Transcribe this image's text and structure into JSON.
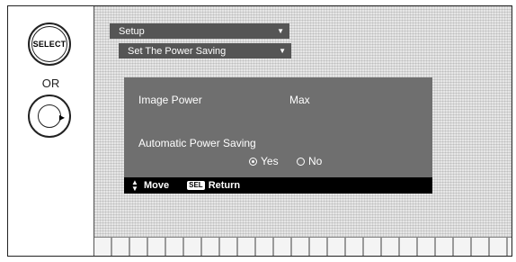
{
  "remote": {
    "select_label": "SELECT",
    "or_label": "OR"
  },
  "menu": {
    "setup_label": "Setup",
    "power_saving_label": "Set The Power Saving",
    "dropdown_glyph": "▼"
  },
  "settings": {
    "image_power_label": "Image Power",
    "image_power_value": "Max",
    "auto_power_label": "Automatic Power Saving",
    "options": [
      {
        "label": "Yes",
        "selected": true
      },
      {
        "label": "No",
        "selected": false
      }
    ]
  },
  "nav": {
    "move_label": "Move",
    "sel_badge": "SEL",
    "return_label": "Return"
  }
}
